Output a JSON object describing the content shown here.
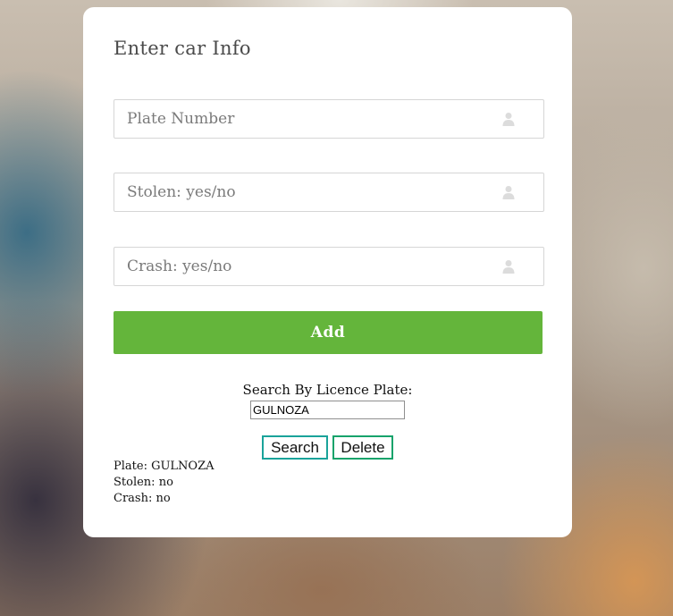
{
  "form": {
    "title": "Enter car Info",
    "fields": [
      {
        "placeholder": "Plate Number",
        "value": "",
        "icon": "user-icon"
      },
      {
        "placeholder": "Stolen: yes/no",
        "value": "",
        "icon": "user-icon"
      },
      {
        "placeholder": "Crash: yes/no",
        "value": "",
        "icon": "user-icon"
      }
    ],
    "add_label": "Add"
  },
  "search": {
    "label": "Search By Licence Plate:",
    "value": "GULNOZA",
    "search_label": "Search",
    "delete_label": "Delete"
  },
  "result": {
    "plate": "Plate: GULNOZA",
    "stolen": "Stolen: no",
    "crash": "Crash: no"
  },
  "colors": {
    "add_button": "#64b53b",
    "search_border": "#1aa39a",
    "delete_border": "#16a36b"
  }
}
